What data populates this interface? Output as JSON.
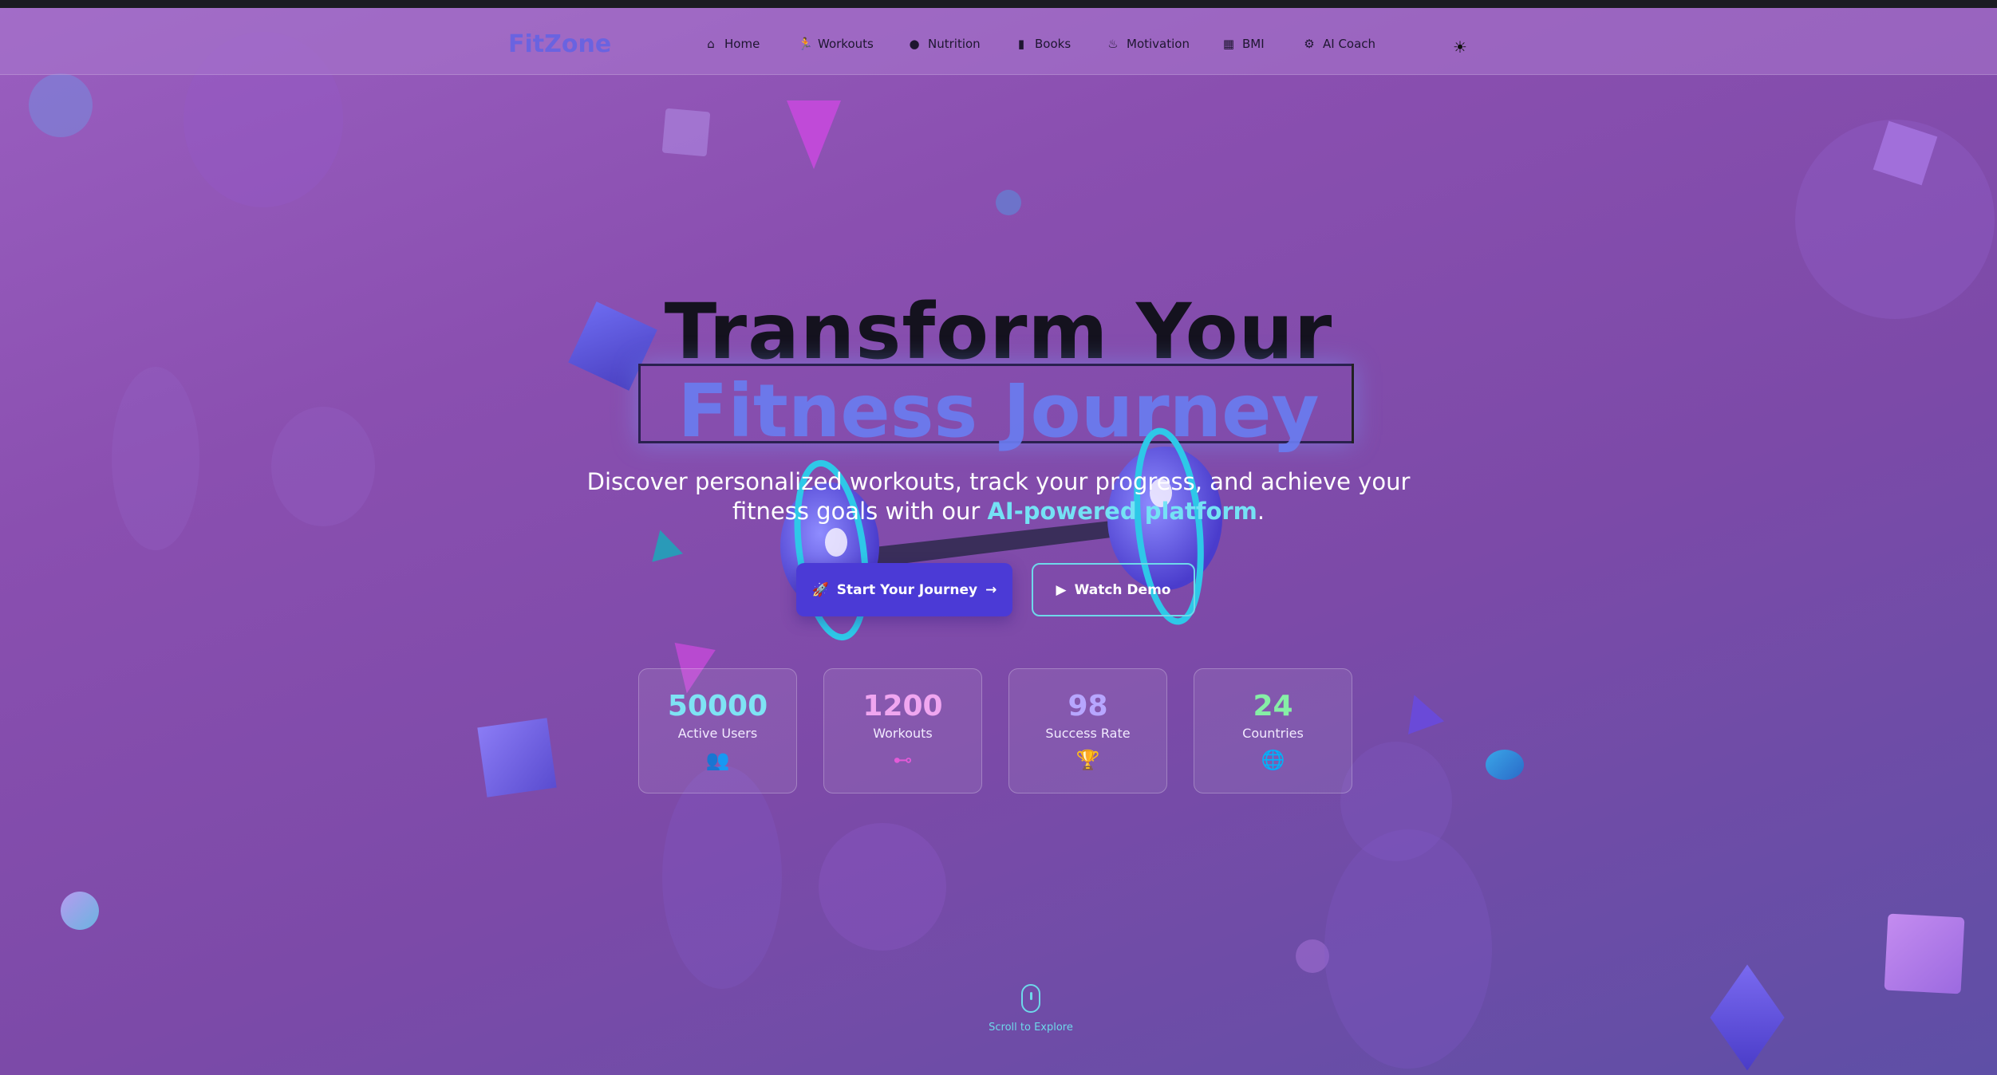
{
  "brand": {
    "name": "FitZone"
  },
  "nav": {
    "items": [
      {
        "label": "Home",
        "icon": "home-icon"
      },
      {
        "label": "Workouts",
        "icon": "running-icon"
      },
      {
        "label": "Nutrition",
        "icon": "apple-icon"
      },
      {
        "label": "Books",
        "icon": "book-icon"
      },
      {
        "label": "Motivation",
        "icon": "fire-icon"
      },
      {
        "label": "BMI",
        "icon": "calculator-icon"
      },
      {
        "label": "AI Coach",
        "icon": "robot-icon"
      }
    ],
    "theme_toggle_icon": "sun-icon"
  },
  "hero": {
    "title_line1": "Transform Your",
    "title_line2": "Fitness Journey",
    "subtitle_part1": "Discover personalized workouts, track your progress, and achieve your",
    "subtitle_part2": "fitness goals with our",
    "subtitle_highlight": "AI-powered platform",
    "subtitle_end": ".",
    "primary_button": "Start Your Journey",
    "secondary_button": "Watch Demo"
  },
  "stats": [
    {
      "value": "50000",
      "label": "Active Users",
      "icon": "users-icon",
      "color": "#7ee3f4"
    },
    {
      "value": "1200",
      "label": "Workouts",
      "icon": "dumbbell-icon",
      "color": "#f0a6f0"
    },
    {
      "value": "98",
      "label": "Success Rate",
      "icon": "trophy-icon",
      "color": "#b7a6ff"
    },
    {
      "value": "24",
      "label": "Countries",
      "icon": "globe-icon",
      "color": "#86efa6"
    }
  ],
  "scroll_hint": {
    "label": "Scroll to Explore"
  },
  "colors": {
    "accent": "#4b3ad6",
    "cyan": "#6ed8ea",
    "brand": "#6a63e0"
  }
}
